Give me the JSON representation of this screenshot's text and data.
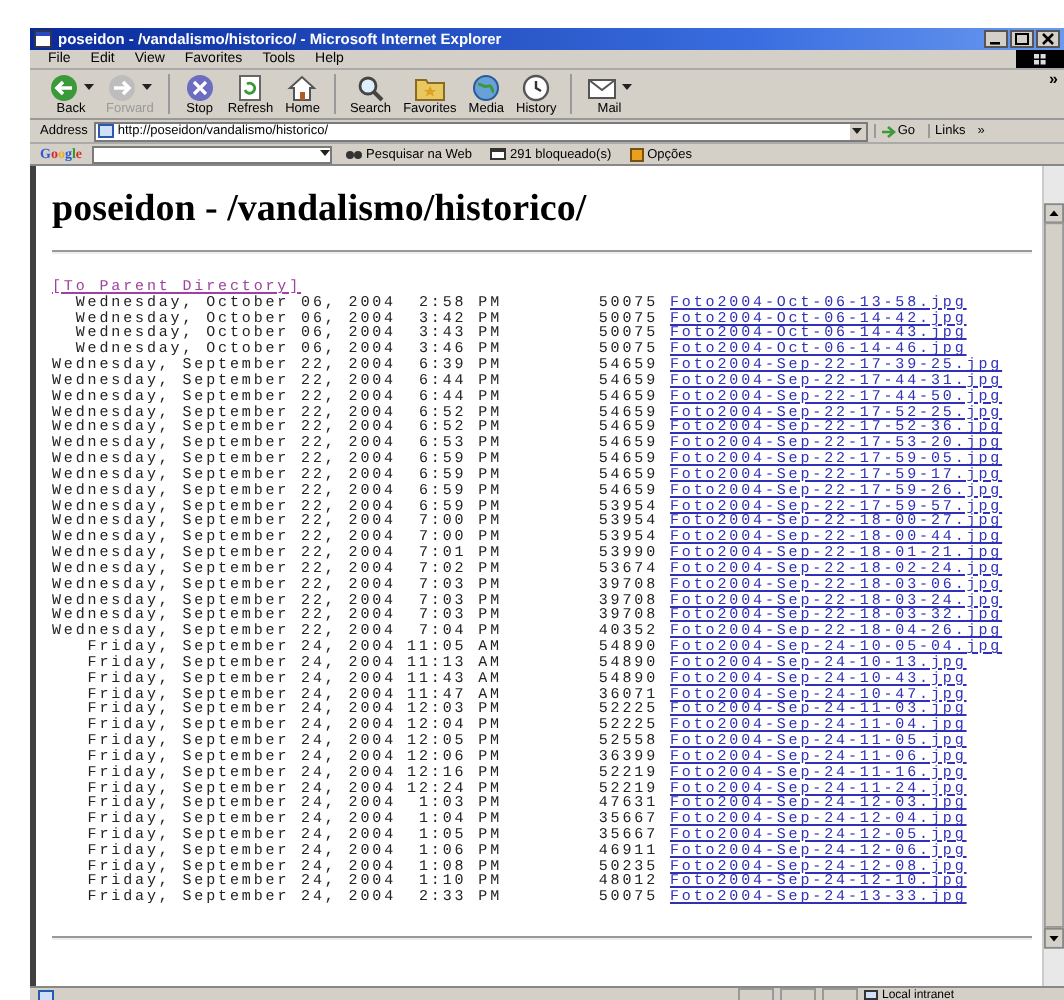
{
  "window": {
    "title": "poseidon - /vandalismo/historico/ - Microsoft Internet Explorer"
  },
  "menu": [
    "File",
    "Edit",
    "View",
    "Favorites",
    "Tools",
    "Help"
  ],
  "toolbar": [
    {
      "label": "Back",
      "disabled": false,
      "dropdown": true
    },
    {
      "label": "Forward",
      "disabled": true,
      "dropdown": true
    },
    {
      "label": "Stop",
      "disabled": false,
      "dropdown": false
    },
    {
      "label": "Refresh",
      "disabled": false,
      "dropdown": false
    },
    {
      "label": "Home",
      "disabled": false,
      "dropdown": false
    },
    {
      "label": "Search",
      "disabled": false,
      "dropdown": false
    },
    {
      "label": "Favorites",
      "disabled": false,
      "dropdown": false
    },
    {
      "label": "Media",
      "disabled": false,
      "dropdown": false
    },
    {
      "label": "History",
      "disabled": false,
      "dropdown": false
    },
    {
      "label": "Mail",
      "disabled": false,
      "dropdown": true
    }
  ],
  "toolbar_more": "»",
  "address": {
    "label": "Address",
    "value": "http://poseidon/vandalismo/historico/",
    "go": "Go",
    "links": "Links",
    "links_more": "»"
  },
  "google_bar": {
    "logo": "Google",
    "search_button": "Pesquisar na Web",
    "blocked": "291 bloqueado(s)",
    "options": "Opções"
  },
  "page": {
    "heading": "poseidon - /vandalismo/historico/",
    "parent_link": {
      "text": "[To Parent Directory]",
      "visited": true
    },
    "rows": [
      {
        "date": "Wednesday, October 06, 2004",
        "time": "2:58 PM",
        "size": "50075",
        "file": "Foto2004-Oct-06-13-58.jpg"
      },
      {
        "date": "Wednesday, October 06, 2004",
        "time": "3:42 PM",
        "size": "50075",
        "file": "Foto2004-Oct-06-14-42.jpg"
      },
      {
        "date": "Wednesday, October 06, 2004",
        "time": "3:43 PM",
        "size": "50075",
        "file": "Foto2004-Oct-06-14-43.jpg"
      },
      {
        "date": "Wednesday, October 06, 2004",
        "time": "3:46 PM",
        "size": "50075",
        "file": "Foto2004-Oct-06-14-46.jpg"
      },
      {
        "date": "Wednesday, September 22, 2004",
        "time": "6:39 PM",
        "size": "54659",
        "file": "Foto2004-Sep-22-17-39-25.jpg"
      },
      {
        "date": "Wednesday, September 22, 2004",
        "time": "6:44 PM",
        "size": "54659",
        "file": "Foto2004-Sep-22-17-44-31.jpg"
      },
      {
        "date": "Wednesday, September 22, 2004",
        "time": "6:44 PM",
        "size": "54659",
        "file": "Foto2004-Sep-22-17-44-50.jpg"
      },
      {
        "date": "Wednesday, September 22, 2004",
        "time": "6:52 PM",
        "size": "54659",
        "file": "Foto2004-Sep-22-17-52-25.jpg"
      },
      {
        "date": "Wednesday, September 22, 2004",
        "time": "6:52 PM",
        "size": "54659",
        "file": "Foto2004-Sep-22-17-52-36.jpg"
      },
      {
        "date": "Wednesday, September 22, 2004",
        "time": "6:53 PM",
        "size": "54659",
        "file": "Foto2004-Sep-22-17-53-20.jpg"
      },
      {
        "date": "Wednesday, September 22, 2004",
        "time": "6:59 PM",
        "size": "54659",
        "file": "Foto2004-Sep-22-17-59-05.jpg"
      },
      {
        "date": "Wednesday, September 22, 2004",
        "time": "6:59 PM",
        "size": "54659",
        "file": "Foto2004-Sep-22-17-59-17.jpg"
      },
      {
        "date": "Wednesday, September 22, 2004",
        "time": "6:59 PM",
        "size": "54659",
        "file": "Foto2004-Sep-22-17-59-26.jpg"
      },
      {
        "date": "Wednesday, September 22, 2004",
        "time": "6:59 PM",
        "size": "53954",
        "file": "Foto2004-Sep-22-17-59-57.jpg"
      },
      {
        "date": "Wednesday, September 22, 2004",
        "time": "7:00 PM",
        "size": "53954",
        "file": "Foto2004-Sep-22-18-00-27.jpg"
      },
      {
        "date": "Wednesday, September 22, 2004",
        "time": "7:00 PM",
        "size": "53954",
        "file": "Foto2004-Sep-22-18-00-44.jpg"
      },
      {
        "date": "Wednesday, September 22, 2004",
        "time": "7:01 PM",
        "size": "53990",
        "file": "Foto2004-Sep-22-18-01-21.jpg"
      },
      {
        "date": "Wednesday, September 22, 2004",
        "time": "7:02 PM",
        "size": "53674",
        "file": "Foto2004-Sep-22-18-02-24.jpg"
      },
      {
        "date": "Wednesday, September 22, 2004",
        "time": "7:03 PM",
        "size": "39708",
        "file": "Foto2004-Sep-22-18-03-06.jpg"
      },
      {
        "date": "Wednesday, September 22, 2004",
        "time": "7:03 PM",
        "size": "39708",
        "file": "Foto2004-Sep-22-18-03-24.jpg"
      },
      {
        "date": "Wednesday, September 22, 2004",
        "time": "7:03 PM",
        "size": "39708",
        "file": "Foto2004-Sep-22-18-03-32.jpg"
      },
      {
        "date": "Wednesday, September 22, 2004",
        "time": "7:04 PM",
        "size": "40352",
        "file": "Foto2004-Sep-22-18-04-26.jpg"
      },
      {
        "date": "Friday, September 24, 2004",
        "time": "11:05 AM",
        "size": "54890",
        "file": "Foto2004-Sep-24-10-05-04.jpg"
      },
      {
        "date": "Friday, September 24, 2004",
        "time": "11:13 AM",
        "size": "54890",
        "file": "Foto2004-Sep-24-10-13.jpg"
      },
      {
        "date": "Friday, September 24, 2004",
        "time": "11:43 AM",
        "size": "54890",
        "file": "Foto2004-Sep-24-10-43.jpg"
      },
      {
        "date": "Friday, September 24, 2004",
        "time": "11:47 AM",
        "size": "36071",
        "file": "Foto2004-Sep-24-10-47.jpg"
      },
      {
        "date": "Friday, September 24, 2004",
        "time": "12:03 PM",
        "size": "52225",
        "file": "Foto2004-Sep-24-11-03.jpg"
      },
      {
        "date": "Friday, September 24, 2004",
        "time": "12:04 PM",
        "size": "52225",
        "file": "Foto2004-Sep-24-11-04.jpg"
      },
      {
        "date": "Friday, September 24, 2004",
        "time": "12:05 PM",
        "size": "52558",
        "file": "Foto2004-Sep-24-11-05.jpg"
      },
      {
        "date": "Friday, September 24, 2004",
        "time": "12:06 PM",
        "size": "36399",
        "file": "Foto2004-Sep-24-11-06.jpg"
      },
      {
        "date": "Friday, September 24, 2004",
        "time": "12:16 PM",
        "size": "52219",
        "file": "Foto2004-Sep-24-11-16.jpg"
      },
      {
        "date": "Friday, September 24, 2004",
        "time": "12:24 PM",
        "size": "52219",
        "file": "Foto2004-Sep-24-11-24.jpg"
      },
      {
        "date": "Friday, September 24, 2004",
        "time": "1:03 PM",
        "size": "47631",
        "file": "Foto2004-Sep-24-12-03.jpg"
      },
      {
        "date": "Friday, September 24, 2004",
        "time": "1:04 PM",
        "size": "35667",
        "file": "Foto2004-Sep-24-12-04.jpg"
      },
      {
        "date": "Friday, September 24, 2004",
        "time": "1:05 PM",
        "size": "35667",
        "file": "Foto2004-Sep-24-12-05.jpg"
      },
      {
        "date": "Friday, September 24, 2004",
        "time": "1:06 PM",
        "size": "46911",
        "file": "Foto2004-Sep-24-12-06.jpg"
      },
      {
        "date": "Friday, September 24, 2004",
        "time": "1:08 PM",
        "size": "50235",
        "file": "Foto2004-Sep-24-12-08.jpg"
      },
      {
        "date": "Friday, September 24, 2004",
        "time": "1:10 PM",
        "size": "48012",
        "file": "Foto2004-Sep-24-12-10.jpg"
      },
      {
        "date": "Friday, September 24, 2004",
        "time": "2:33 PM",
        "size": "50075",
        "file": "Foto2004-Sep-24-13-33.jpg"
      }
    ]
  },
  "status_bar": {
    "zone": "Local intranet"
  }
}
